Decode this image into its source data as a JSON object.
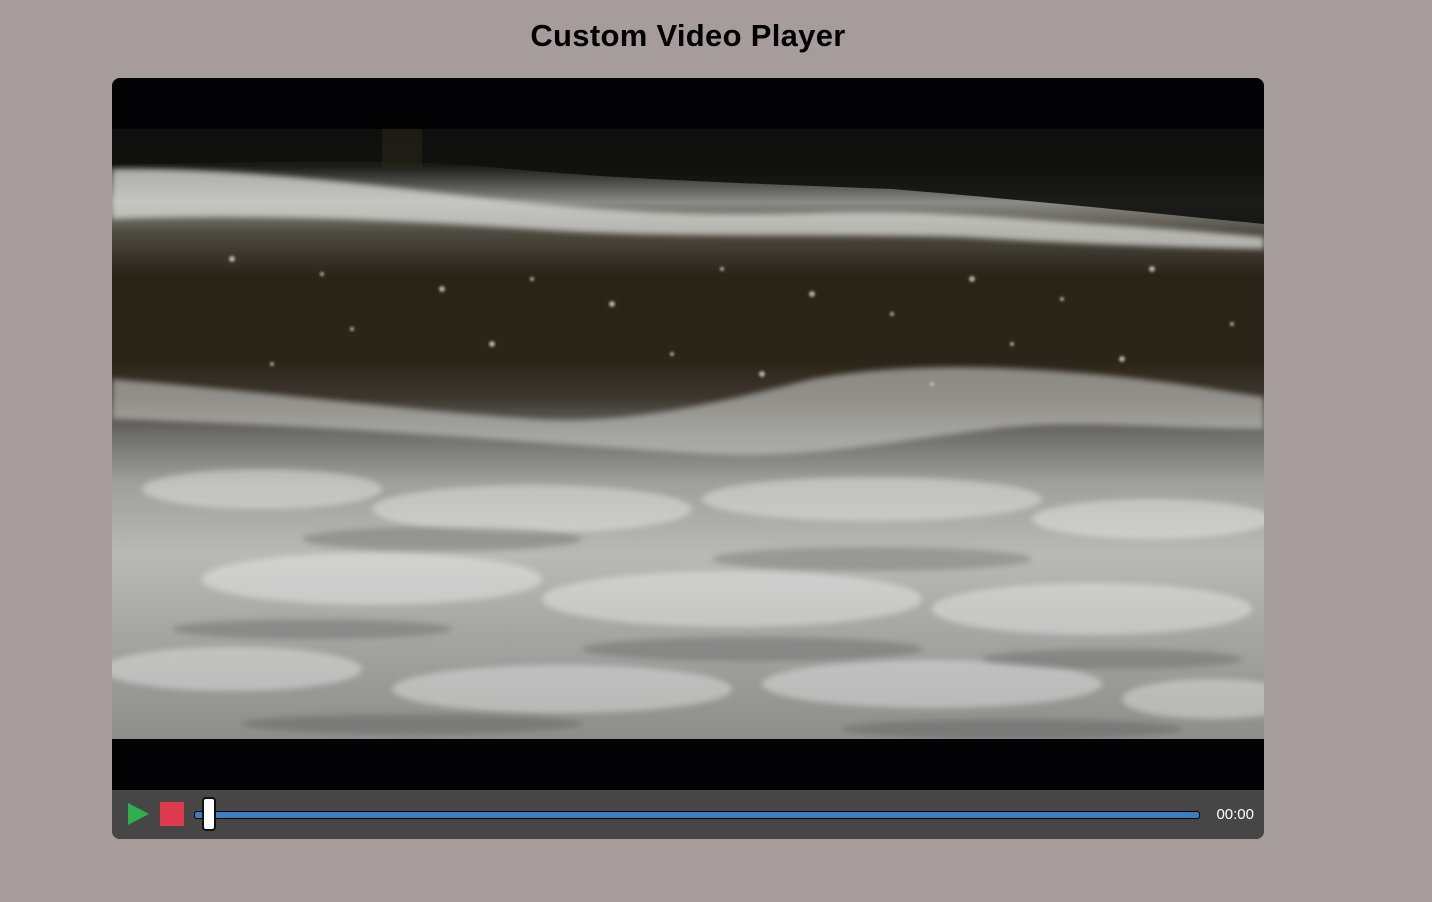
{
  "page": {
    "title": "Custom Video Player"
  },
  "player": {
    "time_display": "00:00",
    "progress_fraction": 0.0,
    "controls": {
      "play_icon": "play-icon",
      "stop_icon": "stop-icon"
    }
  },
  "colors": {
    "background": "#a69c9b",
    "play": "#2eb050",
    "stop": "#e03a4e",
    "progress": "#3a7dc0",
    "control_bar": "#464646"
  }
}
